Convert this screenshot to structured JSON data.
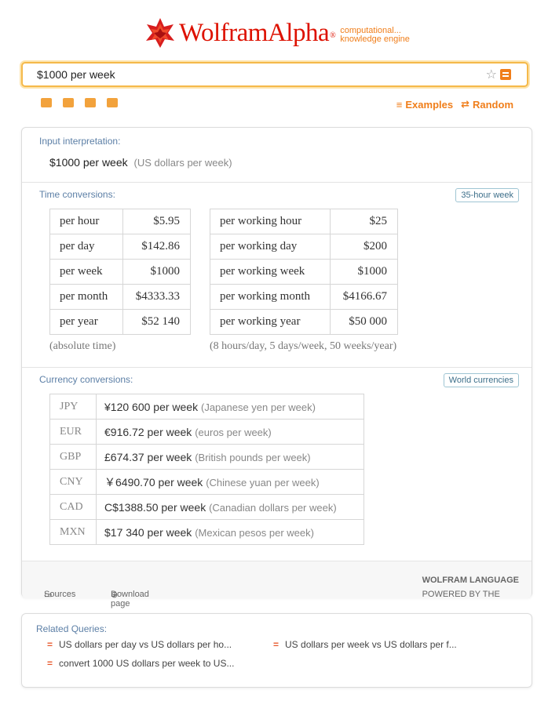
{
  "brand": {
    "name": "WolframAlpha",
    "tagline_1": "computational...",
    "tagline_2": "knowledge engine",
    "accent": "#dd1100",
    "orange": "#f07e1a"
  },
  "search": {
    "value": "$1000 per week"
  },
  "toolbar": {
    "examples": "Examples",
    "random": "Random"
  },
  "input_interpretation": {
    "title": "Input interpretation:",
    "query": "$1000 per week",
    "unit": "(US dollars per week)"
  },
  "time_conversions": {
    "title": "Time conversions:",
    "button": "35-hour week",
    "absolute": [
      {
        "label": "per hour",
        "value": "$5.95"
      },
      {
        "label": "per day",
        "value": "$142.86"
      },
      {
        "label": "per week",
        "value": "$1000"
      },
      {
        "label": "per month",
        "value": "$4333.33"
      },
      {
        "label": "per year",
        "value": "$52 140"
      }
    ],
    "absolute_note": "(absolute time)",
    "working": [
      {
        "label": "per working hour",
        "value": "$25"
      },
      {
        "label": "per working day",
        "value": "$200"
      },
      {
        "label": "per working week",
        "value": "$1000"
      },
      {
        "label": "per working month",
        "value": "$4166.67"
      },
      {
        "label": "per working year",
        "value": "$50 000"
      }
    ],
    "working_note": "(8 hours/day, 5 days/week, 50 weeks/year)"
  },
  "currency_conversions": {
    "title": "Currency conversions:",
    "button": "World currencies",
    "rows": [
      {
        "code": "JPY",
        "amount": "¥120 600 per week",
        "desc": "(Japanese yen per week)"
      },
      {
        "code": "EUR",
        "amount": "€916.72 per week",
        "desc": "(euros per week)"
      },
      {
        "code": "GBP",
        "amount": "£674.37 per week",
        "desc": "(British pounds per week)"
      },
      {
        "code": "CNY",
        "amount": "￥6490.70 per week",
        "desc": "(Chinese yuan per week)"
      },
      {
        "code": "CAD",
        "amount": "C$1388.50 per week",
        "desc": "(Canadian dollars per week)"
      },
      {
        "code": "MXN",
        "amount": "$17 340 per week",
        "desc": "(Mexican pesos per week)"
      }
    ]
  },
  "footer": {
    "sources": "Sources",
    "download": "Download page",
    "powered": "POWERED BY THE",
    "language": "WOLFRAM LANGUAGE"
  },
  "related": {
    "title": "Related Queries:",
    "items": [
      "US dollars per day vs US dollars per ho...",
      "US dollars per week vs US dollars per f...",
      "convert 1000 US dollars per week to US..."
    ]
  }
}
